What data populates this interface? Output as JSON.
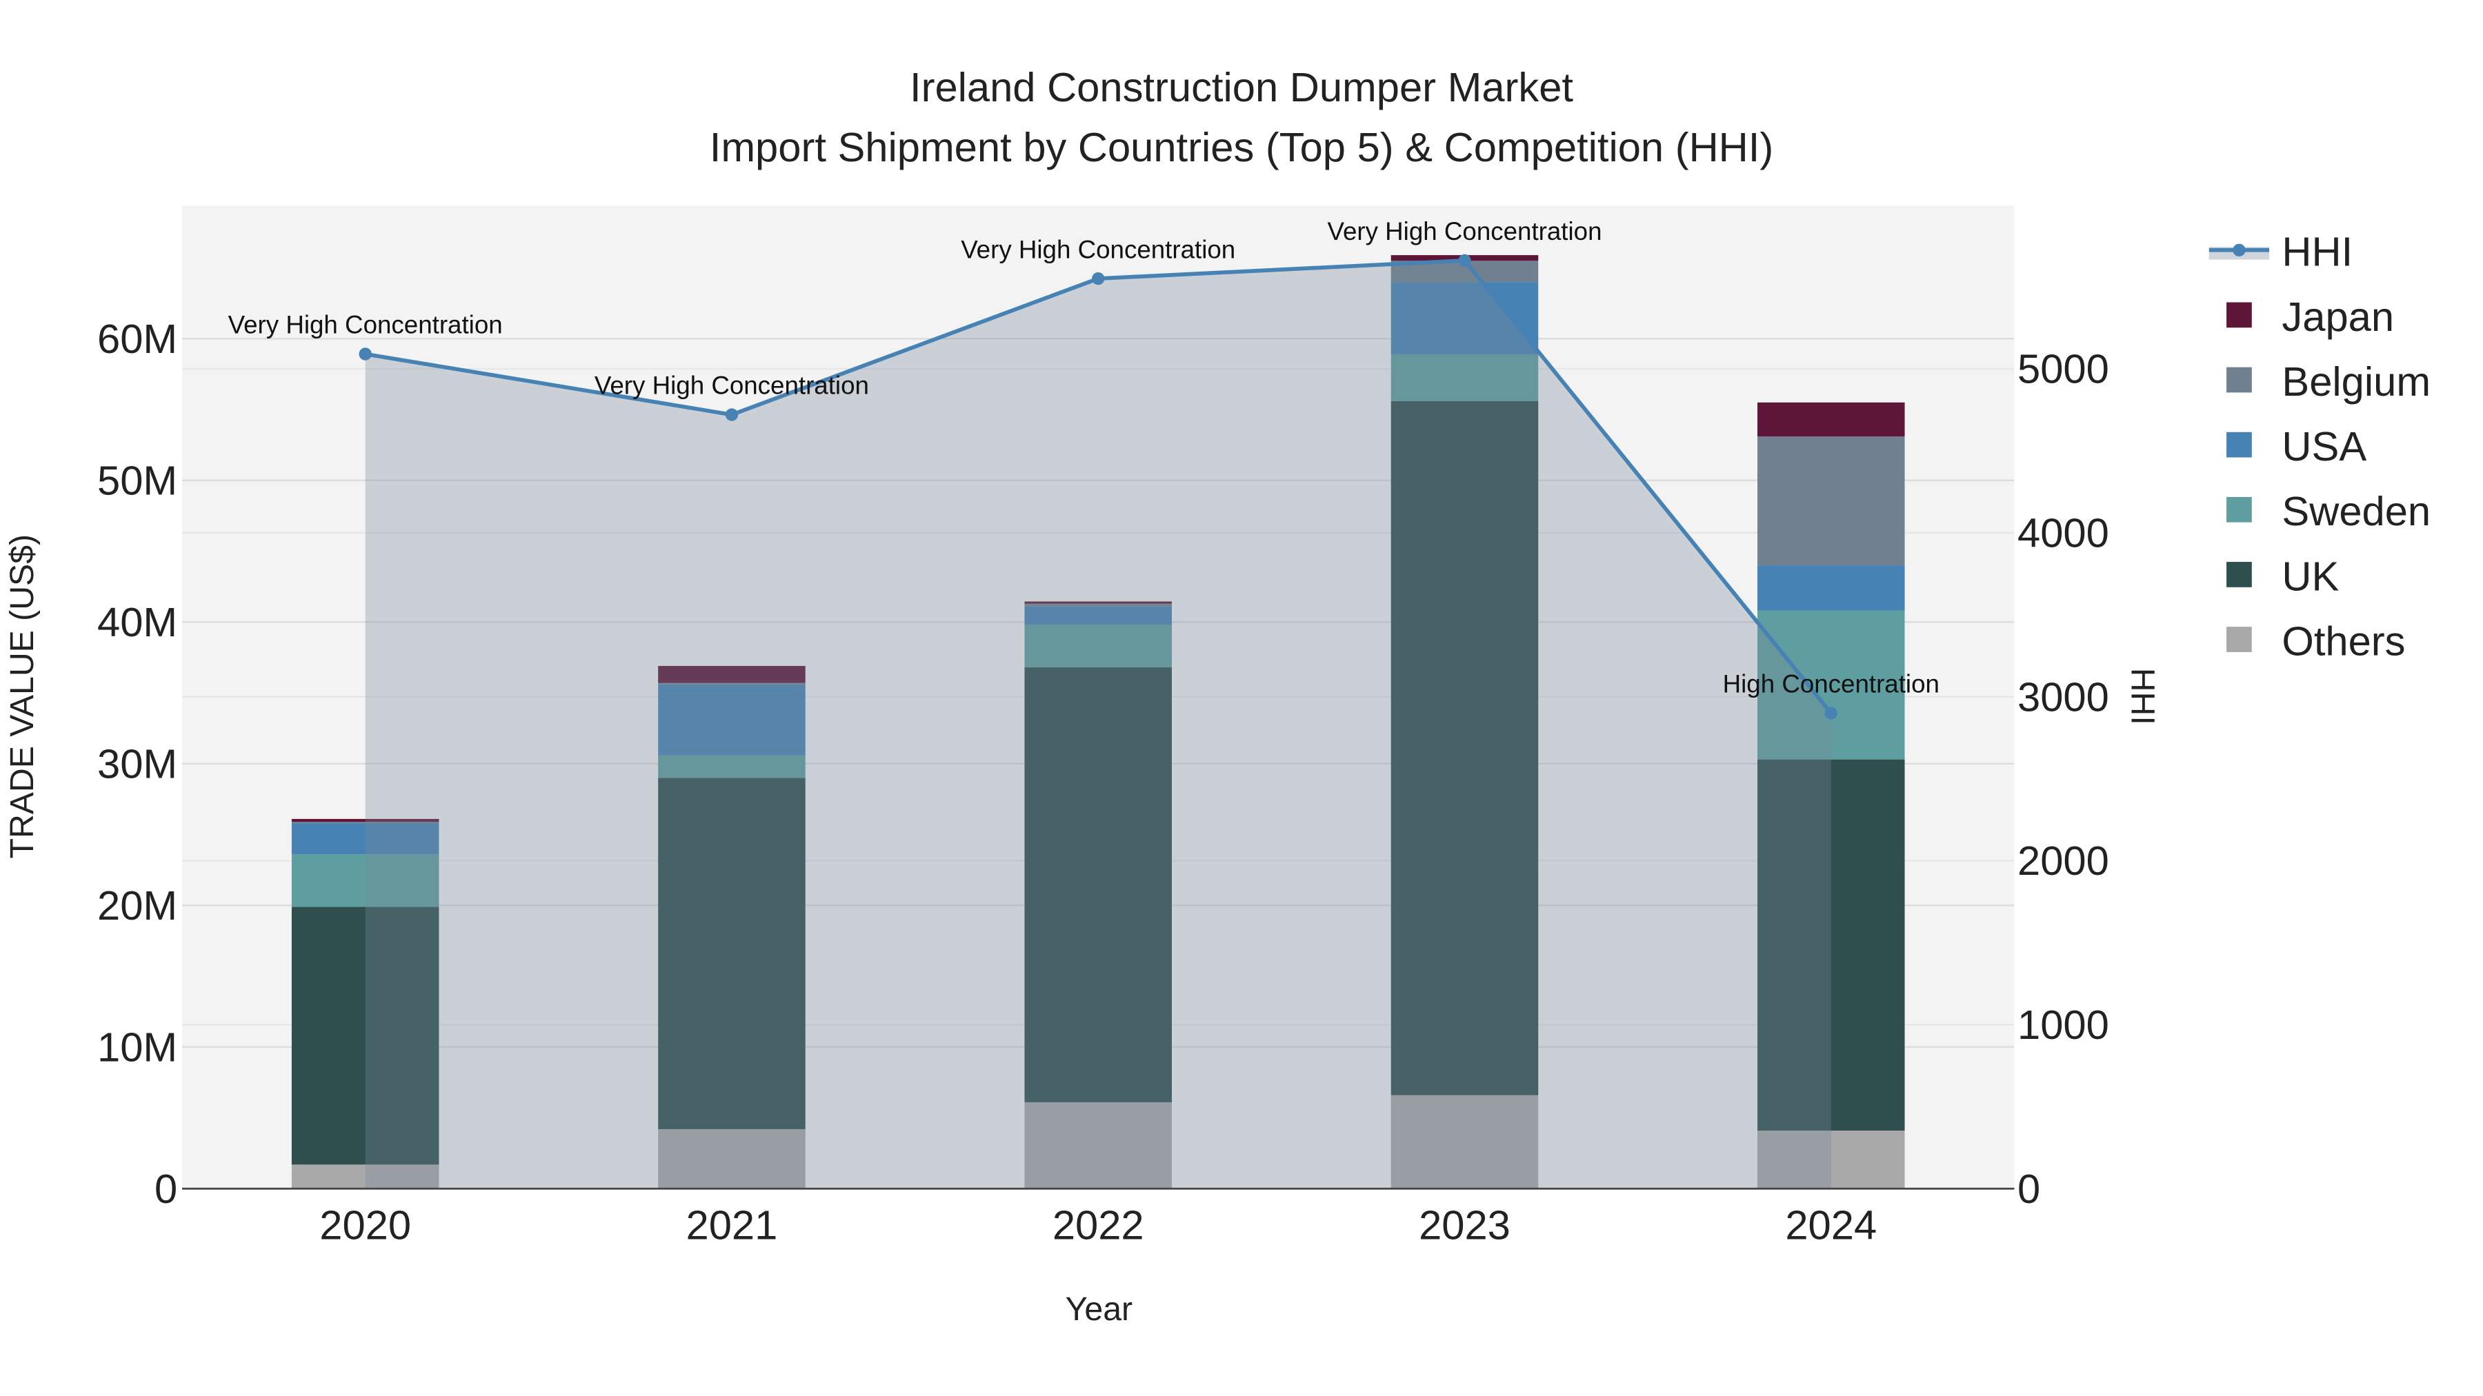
{
  "chart_data": {
    "type": "bar",
    "title": "Ireland Construction Dumper Market",
    "subtitle": "Import Shipment by Countries (Top 5) & Competition (HHI)",
    "xlabel": "Year",
    "ylabel": "TRADE VALUE (US$)",
    "y2label": "HHI",
    "categories": [
      "2020",
      "2021",
      "2022",
      "2023",
      "2024"
    ],
    "ylim": [
      0,
      69000000
    ],
    "y2lim": [
      0,
      6000
    ],
    "yticks": [
      0,
      10000000,
      20000000,
      30000000,
      40000000,
      50000000,
      60000000
    ],
    "ytick_labels": [
      "0",
      "10M",
      "20M",
      "30M",
      "40M",
      "50M",
      "60M"
    ],
    "y2ticks": [
      0,
      1000,
      2000,
      3000,
      4000,
      5000
    ],
    "y2tick_labels": [
      "0",
      "1000",
      "2000",
      "3000",
      "4000",
      "5000"
    ],
    "stacked": true,
    "series": [
      {
        "name": "Others",
        "color": "#a9a9a9",
        "values": [
          1700000,
          4200000,
          6100000,
          6600000,
          4100000
        ]
      },
      {
        "name": "UK",
        "color": "#2f4f4f",
        "values": [
          18200000,
          24800000,
          30700000,
          49000000,
          26200000
        ]
      },
      {
        "name": "Sweden",
        "color": "#5f9ea0",
        "values": [
          3700000,
          1600000,
          3000000,
          3300000,
          10500000
        ]
      },
      {
        "name": "USA",
        "color": "#4682b4",
        "values": [
          2200000,
          5000000,
          1300000,
          5100000,
          3200000
        ]
      },
      {
        "name": "Belgium",
        "color": "#708090",
        "values": [
          100000,
          100000,
          200000,
          1500000,
          9100000
        ]
      },
      {
        "name": "Japan",
        "color": "#5e1638",
        "values": [
          200000,
          1200000,
          150000,
          400000,
          2400000
        ]
      }
    ],
    "hhi": {
      "name": "HHI",
      "color": "#4682b4",
      "values": [
        5090,
        4720,
        5550,
        5660,
        2900
      ],
      "annotations": [
        "Very High Concentration",
        "Very High Concentration",
        "Very High Concentration",
        "Very High Concentration",
        "High Concentration"
      ]
    },
    "legend": {
      "placement": "right",
      "order": [
        "HHI",
        "Japan",
        "Belgium",
        "USA",
        "Sweden",
        "UK",
        "Others"
      ]
    },
    "grid": true
  }
}
